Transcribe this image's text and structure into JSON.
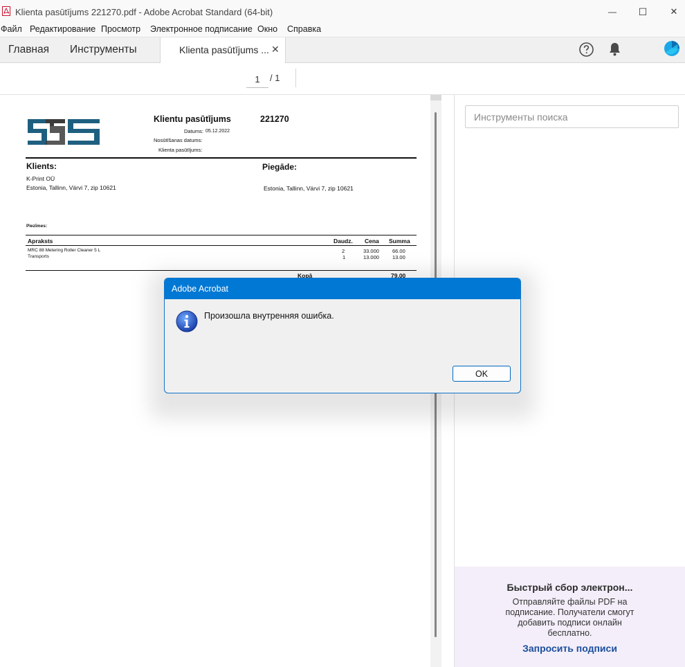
{
  "window": {
    "title": "Klienta pasūtījums 221270.pdf - Adobe Acrobat Standard (64-bit)",
    "controls": {
      "minimize": "—",
      "maximize": "☐",
      "close": "✕"
    }
  },
  "menu": [
    "Файл",
    "Редактирование",
    "Просмотр",
    "Электронное подписание",
    "Окно",
    "Справка"
  ],
  "tabs": {
    "home": "Главная",
    "tools": "Инструменты",
    "document": "Klienta pasūtījums ...",
    "close": "✕"
  },
  "toolbar_icons": {
    "help": "help-icon",
    "notifications": "bell-icon",
    "account": "avatar"
  },
  "pager": {
    "current": "1",
    "total": "/ 1"
  },
  "invoice": {
    "title": "Klientu pasūtījums",
    "number": "221270",
    "date_label": "Datums:",
    "date_value": "05.12.2022",
    "ship_date_label": "Nosūtīšanas datums:",
    "client_order_label": "Klienta pasūtījums:",
    "client_heading": "Klients:",
    "client_name": "K-Print OÜ",
    "client_address": "Estonia, Tallinn, Värvi 7, zip 10621",
    "delivery_heading": "Piegāde:",
    "delivery_address": "Estonia, Tallinn, Värvi 7, zip 10621",
    "notes_label": "Piezīmes:",
    "columns": [
      "Apraksts",
      "Daudz.",
      "Cena",
      "Summa"
    ],
    "rows": [
      {
        "description": "MRC 88 Metering Roller Cleaner 5 L",
        "qty": "2",
        "price": "33.000",
        "sum": "66.00"
      },
      {
        "description": "Transports",
        "qty": "1",
        "price": "13.000",
        "sum": "13.00"
      }
    ],
    "total_label": "Kopā",
    "total_value": "79.00"
  },
  "right_panel": {
    "search_placeholder": "Инструменты поиска",
    "promo_title": "Быстрый сбор электрон...",
    "promo_text": "Отправляйте файлы PDF на подписание. Получатели смогут добавить подписи онлайн бесплатно.",
    "promo_link": "Запросить подписи"
  },
  "dialog": {
    "title": "Adobe Acrobat",
    "message": "Произошла внутренняя ошибка.",
    "ok": "OK"
  },
  "colors": {
    "accent": "#0078d4",
    "logo_primary": "#1e5f80",
    "logo_secondary": "#3b3b3b",
    "promo_bg": "#f3eef9",
    "link": "#1b4e9c"
  }
}
